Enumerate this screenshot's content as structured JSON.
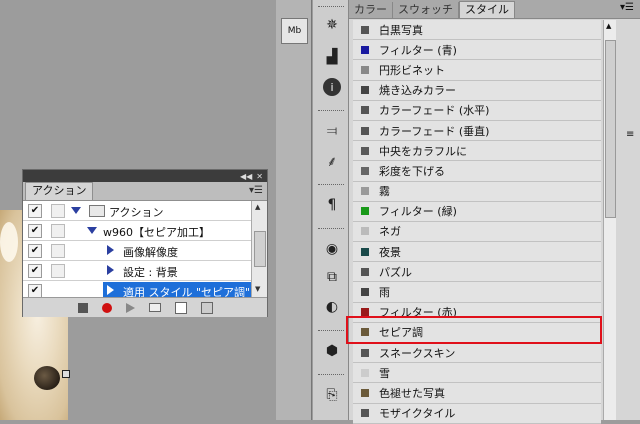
{
  "canvas": {
    "name": "document-canvas"
  },
  "actions_panel": {
    "tab": "アクション",
    "items": [
      {
        "label": "アクション",
        "kind": "set",
        "checked": true
      },
      {
        "label": "w960【セピア加工】",
        "kind": "action",
        "checked": true
      },
      {
        "label": "画像解像度",
        "kind": "step",
        "checked": true
      },
      {
        "label": "設定 : 背景",
        "kind": "step",
        "checked": true
      },
      {
        "label": "適用 スタイル \"セピア調\"",
        "kind": "step",
        "checked": true,
        "selected": true
      }
    ],
    "bottom_buttons": [
      "stop-button",
      "record-button",
      "play-button",
      "new-set-button",
      "new-action-button",
      "delete-button"
    ]
  },
  "dock": {
    "mini_button": "Mb",
    "icons": [
      "navigator-icon",
      "histogram-icon",
      "info-icon",
      "adjustments-icon",
      "brush-icon",
      "paragraph-icon",
      "3d-rotate-icon",
      "clone-icon",
      "mask-icon",
      "3d-cube-icon",
      "history-icon"
    ]
  },
  "style_panel": {
    "tabs": [
      "カラー",
      "スウォッチ",
      "スタイル"
    ],
    "active_tab": "スタイル",
    "items": [
      {
        "label": "白黒写真",
        "color": "#555555"
      },
      {
        "label": "フィルター (青)",
        "color": "#1a1aa0"
      },
      {
        "label": "円形ビネット",
        "color": "#888888"
      },
      {
        "label": "焼き込みカラー",
        "color": "#444444"
      },
      {
        "label": "カラーフェード (水平)",
        "color": "#555555"
      },
      {
        "label": "カラーフェード (垂直)",
        "color": "#555555"
      },
      {
        "label": "中央をカラフルに",
        "color": "#5a5a5a"
      },
      {
        "label": "彩度を下げる",
        "color": "#666666"
      },
      {
        "label": "霧",
        "color": "#9a9a9a"
      },
      {
        "label": "フィルター (緑)",
        "color": "#1a9a1a"
      },
      {
        "label": "ネガ",
        "color": "#bbbbbb"
      },
      {
        "label": "夜景",
        "color": "#1a4a4a"
      },
      {
        "label": "パズル",
        "color": "#555555"
      },
      {
        "label": "雨",
        "color": "#444444"
      },
      {
        "label": "フィルター (赤)",
        "color": "#9a1a1a"
      },
      {
        "label": "セピア調",
        "color": "#6b5a3a",
        "highlighted": true
      },
      {
        "label": "スネークスキン",
        "color": "#555555"
      },
      {
        "label": "雪",
        "color": "#cccccc"
      },
      {
        "label": "色褪せた写真",
        "color": "#6b5a3a"
      },
      {
        "label": "モザイクタイル",
        "color": "#555555"
      }
    ]
  },
  "colors": {
    "selection": "#1e6fd9",
    "highlight": "#e0101a"
  }
}
